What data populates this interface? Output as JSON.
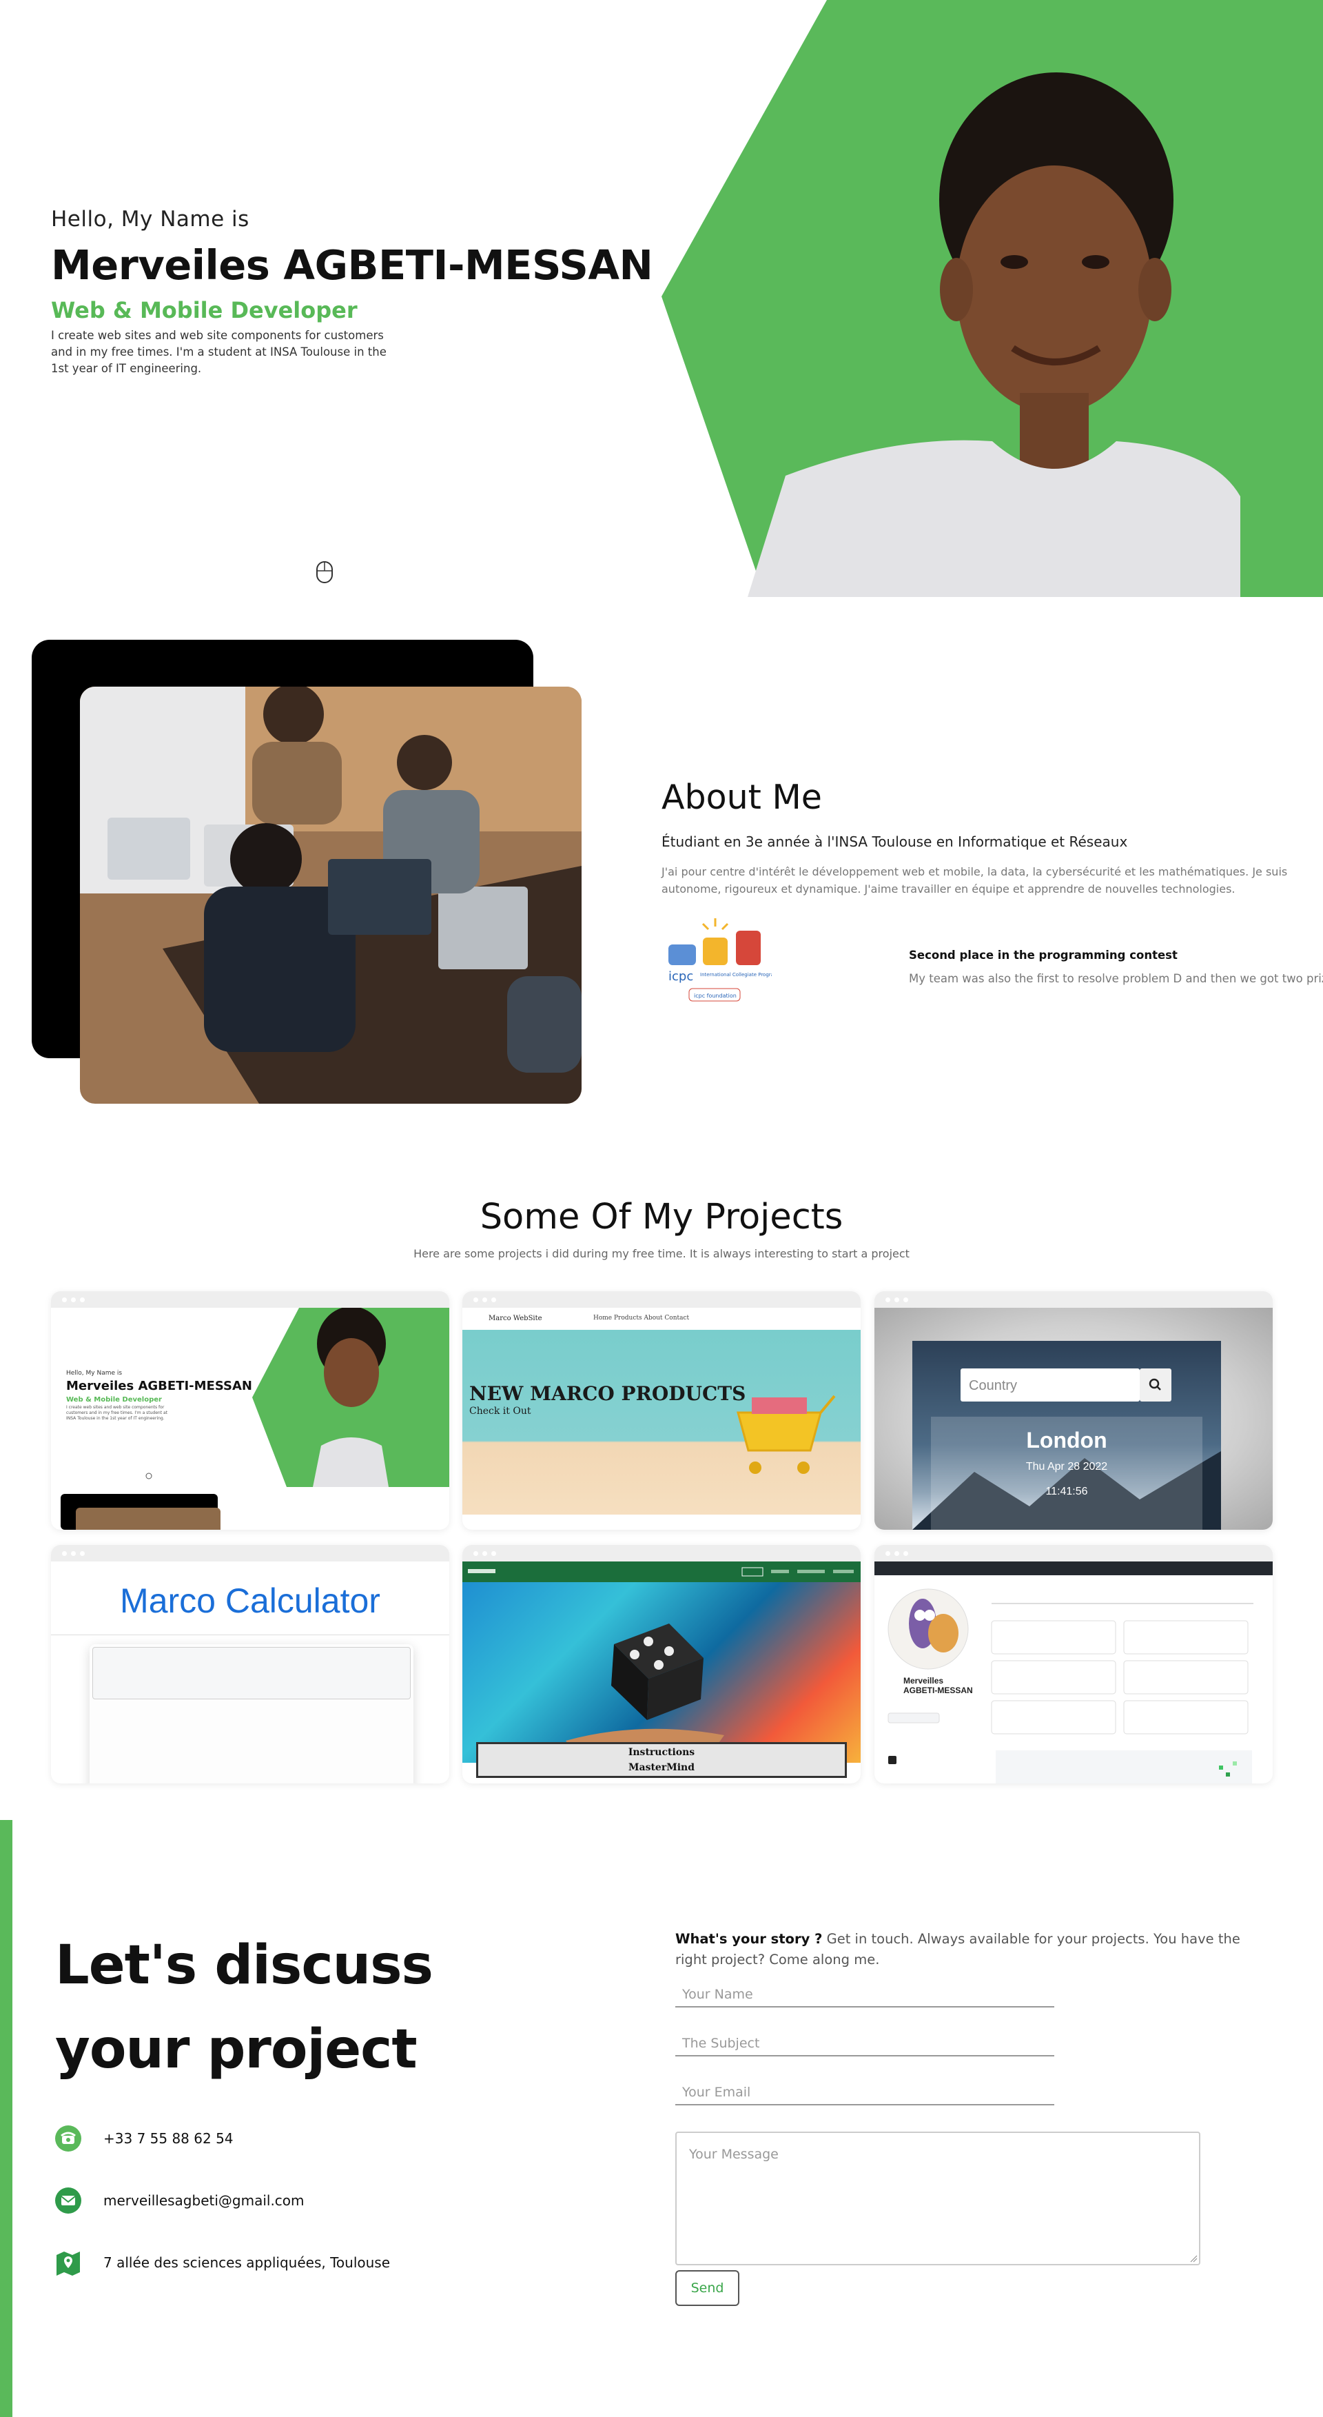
{
  "hero": {
    "greeting": "Hello, My Name is",
    "name": "Merveiles AGBETI-MESSAN",
    "role": "Web & Mobile Developer",
    "description": "I create web sites and web site components for customers and in my free times. I'm a student at INSA Toulouse in the 1st year of IT engineering."
  },
  "about": {
    "title": "About Me",
    "subtitle": "Étudiant en 3e année à l'INSA Toulouse en Informatique et Réseaux",
    "description": "J'ai pour centre d'intérêt le développement web et mobile, la data, la cybersécurité et les mathématiques. Je suis autonome, rigoureux et dynamique. J'aime travailler en équipe et apprendre de nouvelles technologies.",
    "award_title": "Second place in the programming contest",
    "award_desc": "My team was also the first to resolve problem D and then we got two prizes.",
    "logo_text": "International Collegiate Programming Contest",
    "logo_foundation": "icpc foundation"
  },
  "projects": {
    "title": "Some Of My Projects",
    "subtitle": "Here are some projects i did during my free time. It is always interesting to start a project",
    "portfolio": {
      "greeting": "Hello, My Name is",
      "name": "Merveiles AGBETI-MESSAN",
      "role": "Web & Mobile Developer",
      "desc": "I create web sites and web site components for customers and in my free times. I'm a student at INSA Toulouse in the 1st year of IT engineering."
    },
    "marco": {
      "brand": "Marco WebSite",
      "links": "Home   Products   About   Contact",
      "headline": "NEW MARCO PRODUCTS",
      "cta": "Check it Out"
    },
    "weather": {
      "placeholder": "Country",
      "city": "London",
      "date": "Thu Apr 28 2022",
      "time": "11:41:56"
    },
    "calculator": {
      "title": "Marco Calculator"
    },
    "mastermind": {
      "instructions": "Instructions",
      "game": "MasterMind"
    },
    "github": {
      "name": "Merveilles AGBETI-MESSAN"
    }
  },
  "contact": {
    "title_line1": "Let's discuss",
    "title_line2": "your project",
    "phone": "+33 7 55 88 62 54",
    "email": "merveillesagbeti@gmail.com",
    "address": "7 allée des sciences appliquées, Toulouse",
    "story_bold": "What's your story ?",
    "story_text": " Get in touch. Always available for your projects. You have the right project? Come along me.",
    "name_placeholder": "Your Name",
    "subject_placeholder": "The Subject",
    "email_placeholder": "Your Email",
    "message_placeholder": "Your Message",
    "send_label": "Send"
  },
  "colors": {
    "accent": "#5ab95a",
    "text": "#111111",
    "muted": "#777777"
  }
}
